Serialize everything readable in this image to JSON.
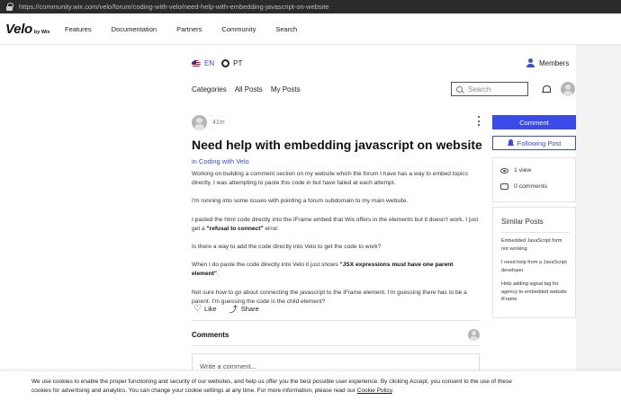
{
  "browser": {
    "url": "https://community.wix.com/velo/forum/coding-with-velo/need-help-with-embedding-javascript-on-website"
  },
  "site": {
    "logo_main": "Velo",
    "logo_by": "by Wix",
    "nav": [
      "Features",
      "Documentation",
      "Partners",
      "Community",
      "Search"
    ]
  },
  "language": {
    "current": "EN",
    "other": "PT"
  },
  "members_label": "Members",
  "forum_tabs": [
    "Categories",
    "All Posts",
    "My Posts"
  ],
  "search": {
    "placeholder": "Search"
  },
  "post": {
    "time": "41m",
    "title": "Need help with embedding javascript on website",
    "category": "in Coding with Velo",
    "paragraphs": [
      {
        "text": "Working on building a comment section on my website which the forum I have has a way to embed topics directly. I was attempting to paste this code in but have failed at each attempt."
      },
      {
        "text": "I'm running into some issues with pointing a forum subdomain to my main website."
      },
      {
        "text": "I pasted the html code directly into the iFrame embed that Wix offers in the elements but it doesn't work. I just get a ",
        "bold": "\"refusal to connect\"",
        "after": " error."
      },
      {
        "text": "Is there a way to add the code directly into Velo to get the code to work?"
      },
      {
        "text": "When I do paste the code directly into Velo it just shows ",
        "bold": "\"JSX expressions must have one parent element\"",
        "after": "."
      },
      {
        "text": "Not sure how to go about connecting the javascript to the iFrame element. I'm guessing there has to be a parent. I'm guessing the code is the child element?"
      }
    ],
    "like_label": "Like",
    "share_label": "Share"
  },
  "comments": {
    "heading": "Comments",
    "placeholder": "Write a comment..."
  },
  "sidebar": {
    "comment_button": "Comment",
    "follow_button": "Following Post",
    "views": "1 view",
    "comments_count": "0 comments",
    "similar_heading": "Similar Posts",
    "similar_posts": [
      "Embedded JavaScript form not working",
      "I need help from a JavaScript developer",
      "Help adding signal tag for agency to embedded website iFrame"
    ]
  },
  "cookie": {
    "text": "We use cookies to enable the proper functioning and security of our websites, and help us offer you the best possible user experience. By clicking Accept, you consent to the use of these cookies for advertising and analytics. You can change your cookie settings at any time. For more information, please read our ",
    "link": "Cookie Policy",
    "after": "."
  },
  "colors": {
    "accent": "#3b4be8"
  }
}
